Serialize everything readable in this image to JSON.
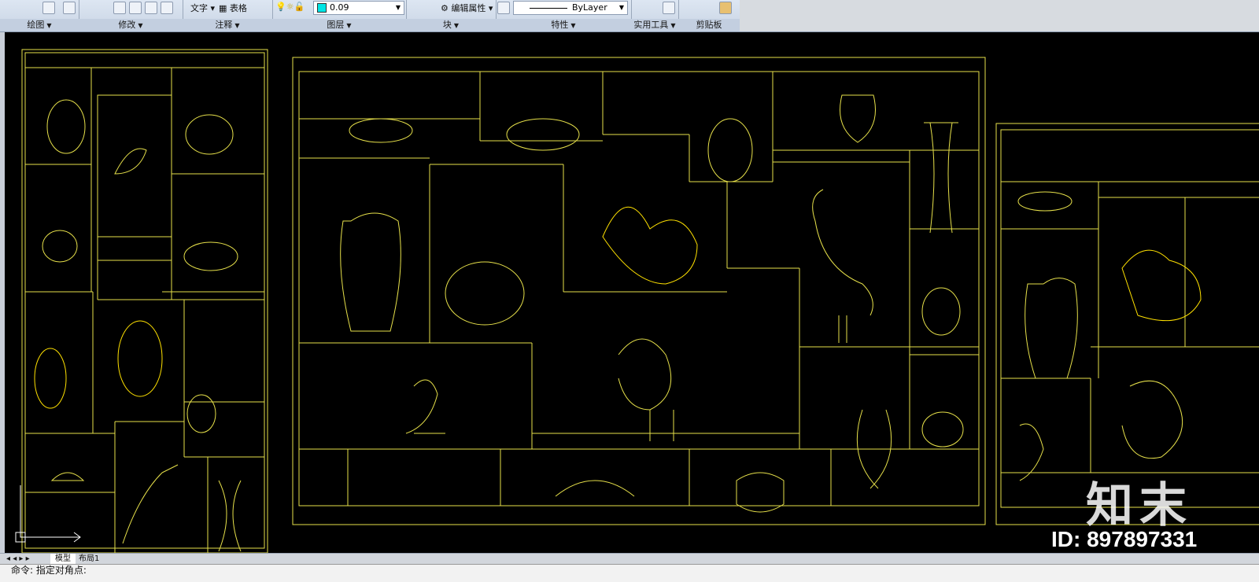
{
  "ribbon": {
    "panels": [
      {
        "title": "绘图"
      },
      {
        "title": "修改"
      },
      {
        "title": "注释"
      },
      {
        "title": "图层"
      },
      {
        "title": "块"
      },
      {
        "title": "特性"
      },
      {
        "title": "实用工具"
      },
      {
        "title": "剪贴板"
      }
    ],
    "annotation": {
      "text_label": "文字",
      "table_label": "表格"
    },
    "layer_value": "0.09",
    "block": {
      "edit_attr_label": "编辑属性"
    },
    "properties": {
      "linetype_value": "ByLayer"
    }
  },
  "tabs": {
    "model": "模型",
    "layout1": "布局1"
  },
  "command_line": "命令: 指定对角点:",
  "watermark": {
    "logo": "知末",
    "id": "ID: 897897331"
  },
  "colors": {
    "drawing_line": "#e6e04a",
    "canvas_bg": "#000000"
  }
}
